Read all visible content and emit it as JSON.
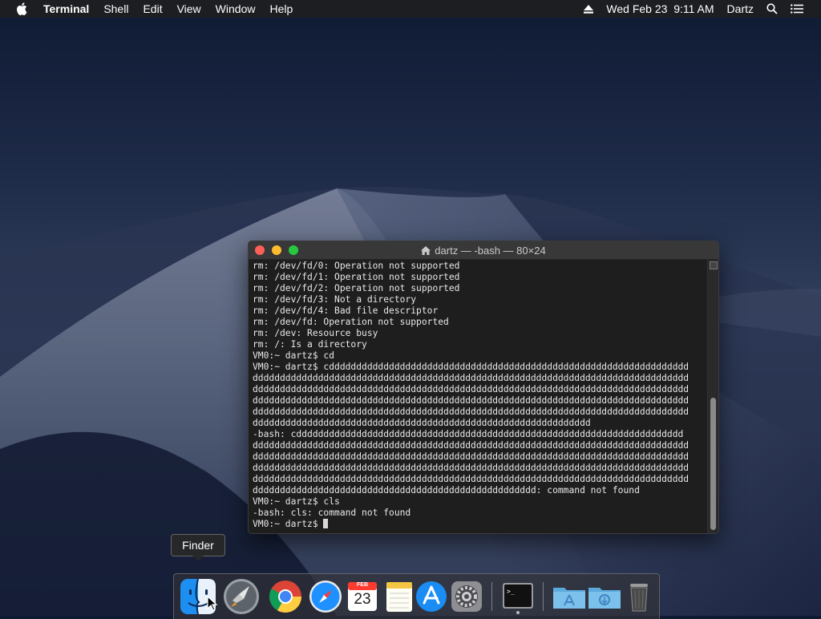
{
  "menubar": {
    "app_name": "Terminal",
    "menus": [
      "Shell",
      "Edit",
      "View",
      "Window",
      "Help"
    ],
    "datetime": "Wed Feb 23  9:11 AM",
    "user": "Dartz"
  },
  "terminal": {
    "title": "dartz — -bash — 80×24",
    "lines": [
      "rm: /dev/fd/0: Operation not supported",
      "rm: /dev/fd/1: Operation not supported",
      "rm: /dev/fd/2: Operation not supported",
      "rm: /dev/fd/3: Not a directory",
      "rm: /dev/fd/4: Bad file descriptor",
      "rm: /dev/fd: Operation not supported",
      "rm: /dev: Resource busy",
      "rm: /: Is a directory",
      "VM0:~ dartz$ cd",
      "VM0:~ dartz$ cdddddddddddddddddddddddddddddddddddddddddddddddddddddddddddddddddd",
      "dddddddddddddddddddddddddddddddddddddddddddddddddddddddddddddddddddddddddddddddd",
      "dddddddddddddddddddddddddddddddddddddddddddddddddddddddddddddddddddddddddddddddd",
      "dddddddddddddddddddddddddddddddddddddddddddddddddddddddddddddddddddddddddddddddd",
      "dddddddddddddddddddddddddddddddddddddddddddddddddddddddddddddddddddddddddddddddd",
      "dddddddddddddddddddddddddddddddddddddddddddddddddddddddddddddd",
      "-bash: cddddddddddddddddddddddddddddddddddddddddddddddddddddddddddddddddddddddd",
      "dddddddddddddddddddddddddddddddddddddddddddddddddddddddddddddddddddddddddddddddd",
      "dddddddddddddddddddddddddddddddddddddddddddddddddddddddddddddddddddddddddddddddd",
      "dddddddddddddddddddddddddddddddddddddddddddddddddddddddddddddddddddddddddddddddd",
      "dddddddddddddddddddddddddddddddddddddddddddddddddddddddddddddddddddddddddddddddd",
      "dddddddddddddddddddddddddddddddddddddddddddddddddddd: command not found",
      "VM0:~ dartz$ cls",
      "-bash: cls: command not found",
      "VM0:~ dartz$ "
    ]
  },
  "tooltip": {
    "label": "Finder"
  },
  "dock": {
    "calendar_month": "FEB",
    "calendar_day": "23",
    "items": [
      "finder-icon",
      "launchpad-icon",
      "chrome-icon",
      "safari-icon",
      "calendar-icon",
      "notes-icon",
      "app-store-icon",
      "system-preferences-icon",
      "terminal-icon",
      "applications-folder-icon",
      "downloads-folder-icon",
      "trash-icon"
    ]
  },
  "colors": {
    "accent_close": "#fe5f57",
    "accent_min": "#febc2e",
    "accent_max": "#28c840",
    "terminal_bg": "#1e1e1e"
  }
}
